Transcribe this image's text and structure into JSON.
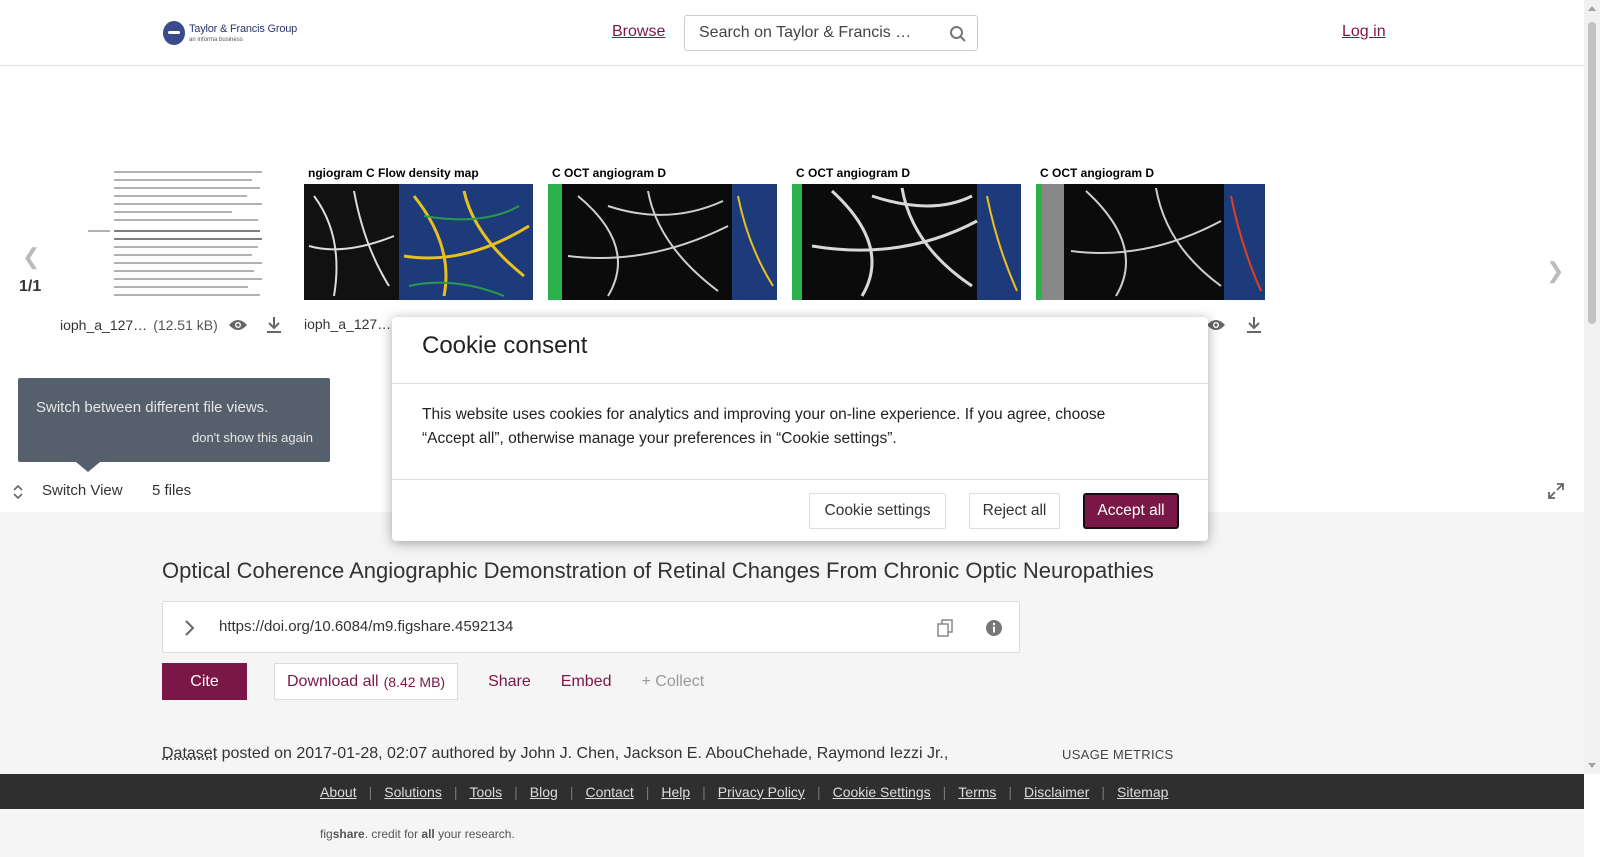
{
  "header": {
    "logo_name": "Taylor & Francis Group",
    "logo_sub": "an informa business",
    "browse_label": "Browse",
    "search_placeholder": "Search on Taylor & Francis …",
    "login_label": "Log in"
  },
  "carousel": {
    "pager": "1/1",
    "thumbnails": [
      {
        "caption": "",
        "filename": "ioph_a_127…",
        "size": "(12.51 kB)"
      },
      {
        "caption": "ngiogram  C  Flow density map",
        "filename": "ioph_a_127…",
        "size": ""
      },
      {
        "caption": "C  OCT angiogram  D",
        "filename": "",
        "size": ""
      },
      {
        "caption": "C  OCT angiogram  D",
        "filename": "",
        "size": ""
      },
      {
        "caption": "C  OCT angiogram  D",
        "filename": "",
        "size": ""
      }
    ]
  },
  "tooltip": {
    "text": "Switch between different file views.",
    "dismiss": "don't show this again"
  },
  "viewbar": {
    "switch_label": "Switch View",
    "files_count": "5 files"
  },
  "article": {
    "title": "Optical Coherence Angiographic Demonstration of Retinal Changes From Chronic Optic Neuropathies",
    "doi": "https://doi.org/10.6084/m9.figshare.4592134",
    "cite_label": "Cite",
    "download_label": "Download all",
    "download_size": "(8.42 MB)",
    "share_label": "Share",
    "embed_label": "Embed",
    "collect_label": "+ Collect",
    "item_type": "Dataset",
    "posted_text": "posted on 2017-01-28, 02:07 authored by John J. Chen, Jackson E. AbouChehade, Raymond Iezzi Jr.,",
    "usage_metrics": "USAGE METRICS"
  },
  "footer": {
    "links": [
      "About",
      "Solutions",
      "Tools",
      "Blog",
      "Contact",
      "Help",
      "Privacy Policy",
      "Cookie Settings",
      "Terms",
      "Disclaimer",
      "Sitemap"
    ],
    "credit_fig": "fig",
    "credit_share": "share",
    "credit_mid": ". credit for ",
    "credit_all": "all",
    "credit_end": " your research."
  },
  "cookie_modal": {
    "title": "Cookie consent",
    "body": "This website uses cookies for analytics and improving your on-line experience. If you agree, choose “Accept all”, otherwise manage your preferences in “Cookie settings”.",
    "settings_label": "Cookie settings",
    "reject_label": "Reject all",
    "accept_label": "Accept all"
  },
  "colors": {
    "brand": "#7b1747",
    "footer_bg": "#2f2f2f",
    "tooltip_bg": "#56606d"
  }
}
